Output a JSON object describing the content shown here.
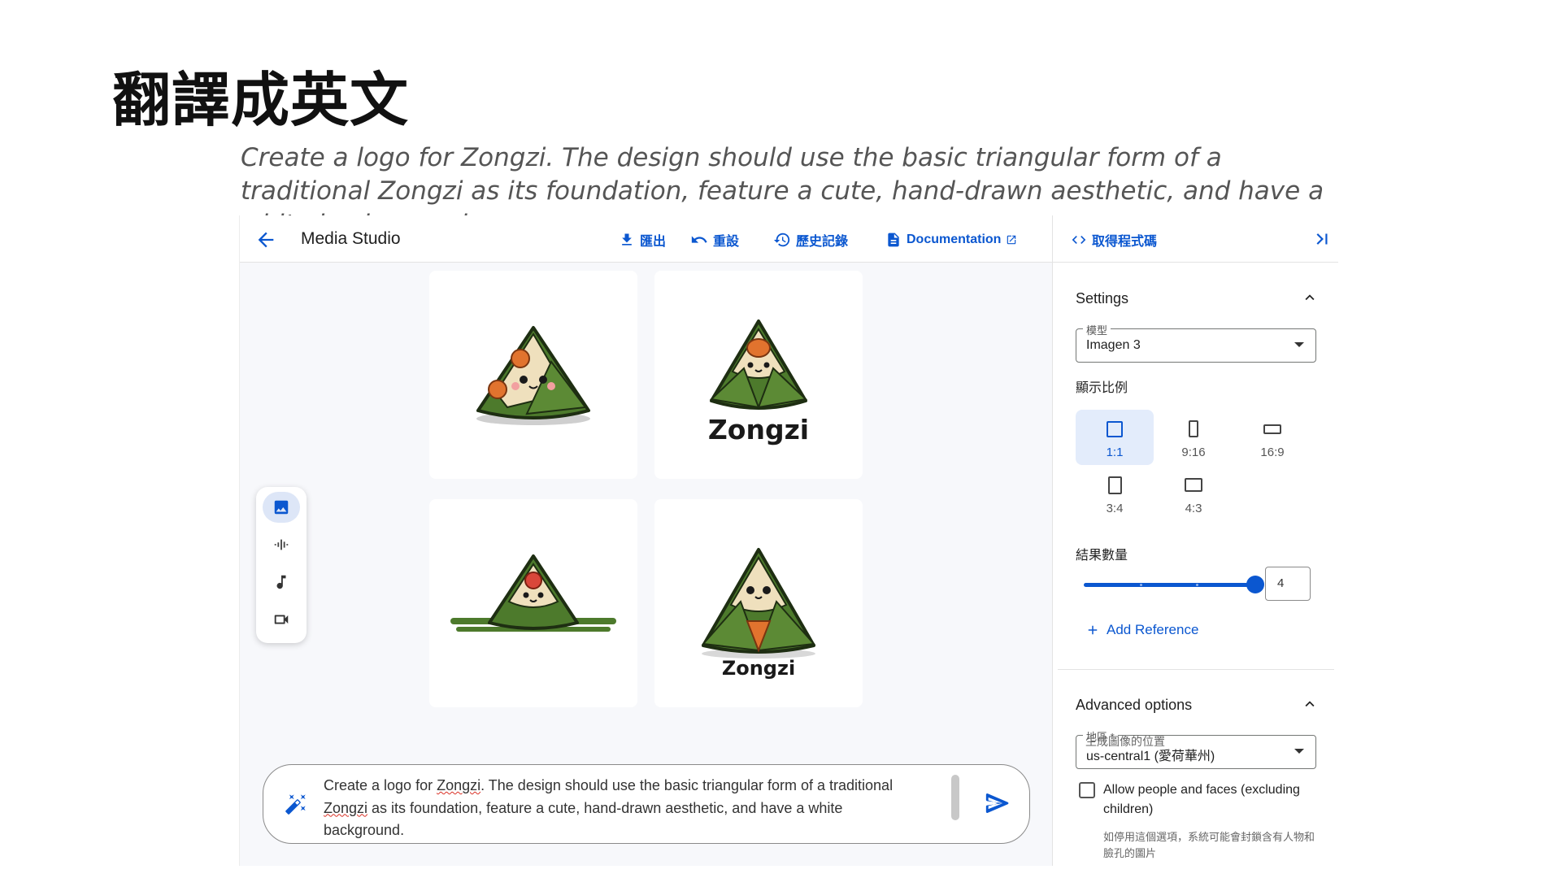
{
  "slide": {
    "title": "翻譯成英文",
    "caption": "Create a logo for Zongzi. The design should use the basic triangular form of a traditional Zongzi as its foundation, feature a cute, hand-drawn aesthetic, and have a white background."
  },
  "app": {
    "name": "Media Studio",
    "toolbar": {
      "export": "匯出",
      "reset": "重設",
      "history": "歷史記錄",
      "docs": "Documentation",
      "get_code": "取得程式碼"
    },
    "results": [
      {
        "label": ""
      },
      {
        "label": "Zongzi"
      },
      {
        "label": ""
      },
      {
        "label": "Zongzi"
      }
    ],
    "prompt": {
      "seg1": "Create a logo for ",
      "word1": "Zongzi",
      "seg2": ". The design should use the basic triangular form of a traditional ",
      "word2": "Zongzi",
      "seg3": " as its foundation, feature a cute, hand-drawn aesthetic, and have a white background."
    },
    "tools": [
      "image-icon",
      "audio-icon",
      "music-icon",
      "video-icon"
    ]
  },
  "settings": {
    "heading": "Settings",
    "model_label": "模型",
    "model_value": "Imagen 3",
    "ratio_label": "顯示比例",
    "ratios": [
      "1:1",
      "9:16",
      "16:9",
      "3:4",
      "4:3"
    ],
    "selected_ratio": "1:1",
    "count_label": "結果數量",
    "count_value": "4",
    "add_reference": "Add Reference"
  },
  "advanced": {
    "heading": "Advanced options",
    "region_label": "地區 *",
    "region_value": "us-central1 (愛荷華州)",
    "region_helper": "生成圖像的位置",
    "people_label": "Allow people and faces (excluding children)",
    "people_note": "如停用這個選項，系統可能會封鎖含有人物和臉孔的圖片"
  },
  "colors": {
    "accent": "#0b57d0",
    "leaf": "#4d7a2c",
    "rice": "#efe0bd",
    "filling": "#e1732e"
  }
}
